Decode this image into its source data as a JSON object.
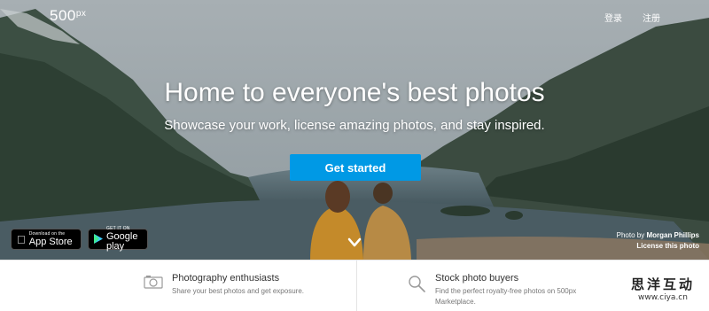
{
  "header": {
    "logo_text": "500",
    "logo_sup": "px",
    "login_label": "登录",
    "signup_label": "注册"
  },
  "hero": {
    "headline": "Home to everyone's best photos",
    "subline": "Showcase your work, license amazing photos, and stay inspired.",
    "cta_label": "Get started",
    "app_store": {
      "small": "Download on the",
      "big": "App Store"
    },
    "google_play": {
      "small": "GET IT ON",
      "big": "Google play"
    },
    "credit_prefix": "Photo by",
    "credit_name": "Morgan Phillips",
    "license_label": "License this photo"
  },
  "features": [
    {
      "icon": "camera-icon",
      "title": "Photography enthusiasts",
      "desc": "Share your best photos and get exposure."
    },
    {
      "icon": "magnifier-icon",
      "title": "Stock photo buyers",
      "desc_line1": "Find the perfect royalty-free photos on 500px",
      "desc_line2": "Marketplace."
    }
  ],
  "watermark": {
    "title": "思洋互动",
    "url": "www.ciya.cn"
  },
  "colors": {
    "accent": "#0099e5"
  }
}
